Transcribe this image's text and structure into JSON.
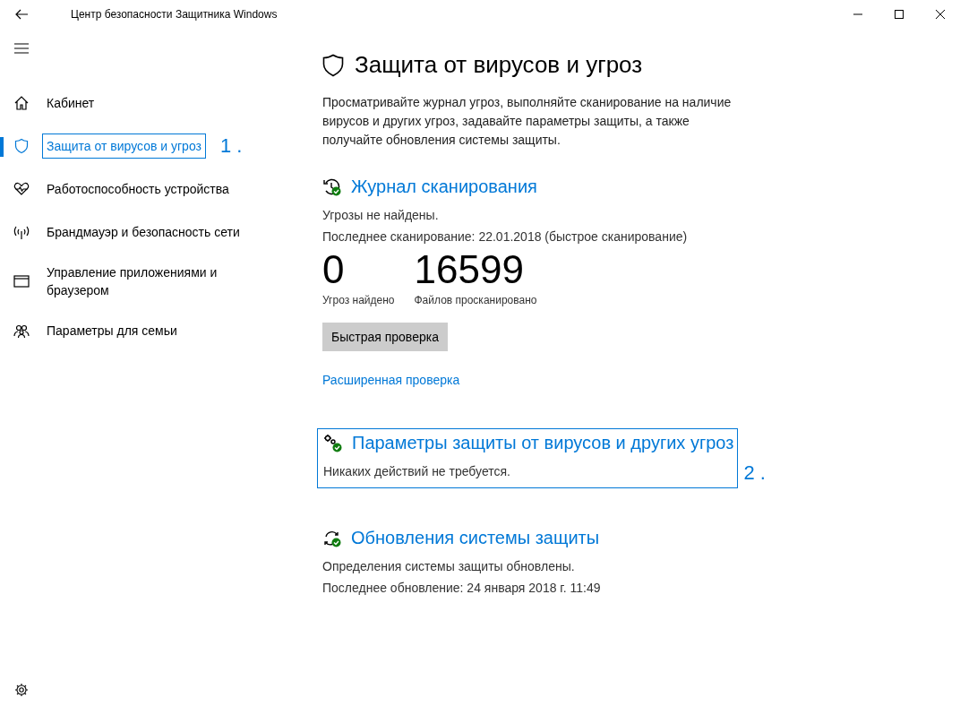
{
  "window": {
    "title": "Центр безопасности Защитника Windows"
  },
  "sidebar": {
    "items": [
      {
        "label": "Кабинет",
        "kind": "home",
        "selected": false
      },
      {
        "label": "Защита от вирусов и угроз",
        "kind": "shield",
        "selected": true,
        "annotation": "1 ."
      },
      {
        "label": "Работоспособность устройства",
        "kind": "heart",
        "selected": false
      },
      {
        "label": "Брандмауэр и безопасность сети",
        "kind": "antenna",
        "selected": false
      },
      {
        "label": "Управление приложениями и браузером",
        "kind": "window",
        "selected": false
      },
      {
        "label": "Параметры для семьи",
        "kind": "family",
        "selected": false
      }
    ]
  },
  "page": {
    "title": "Защита от вирусов и угроз",
    "description": "Просматривайте журнал угроз, выполняйте сканирование на наличие вирусов и других угроз, задавайте параметры защиты, а также получайте обновления системы защиты."
  },
  "sections": [
    {
      "kind": "history",
      "title": "Журнал сканирования",
      "lines": [
        "Угрозы не найдены.",
        "Последнее сканирование: 22.01.2018 (быстрое сканирование)"
      ],
      "stats": [
        {
          "value": "0",
          "label": "Угроз найдено"
        },
        {
          "value": "16599",
          "label": "Файлов просканировано"
        }
      ],
      "button": "Быстрая проверка",
      "link": "Расширенная проверка"
    },
    {
      "kind": "gears",
      "title": "Параметры защиты от вирусов и других угроз",
      "lines": [
        "Никаких действий не требуется."
      ],
      "annotation": "2 ."
    },
    {
      "kind": "refresh",
      "title": "Обновления системы защиты",
      "lines": [
        "Определения системы защиты обновлены.",
        "Последнее обновление: 24 января 2018 г. 11:49"
      ]
    }
  ]
}
